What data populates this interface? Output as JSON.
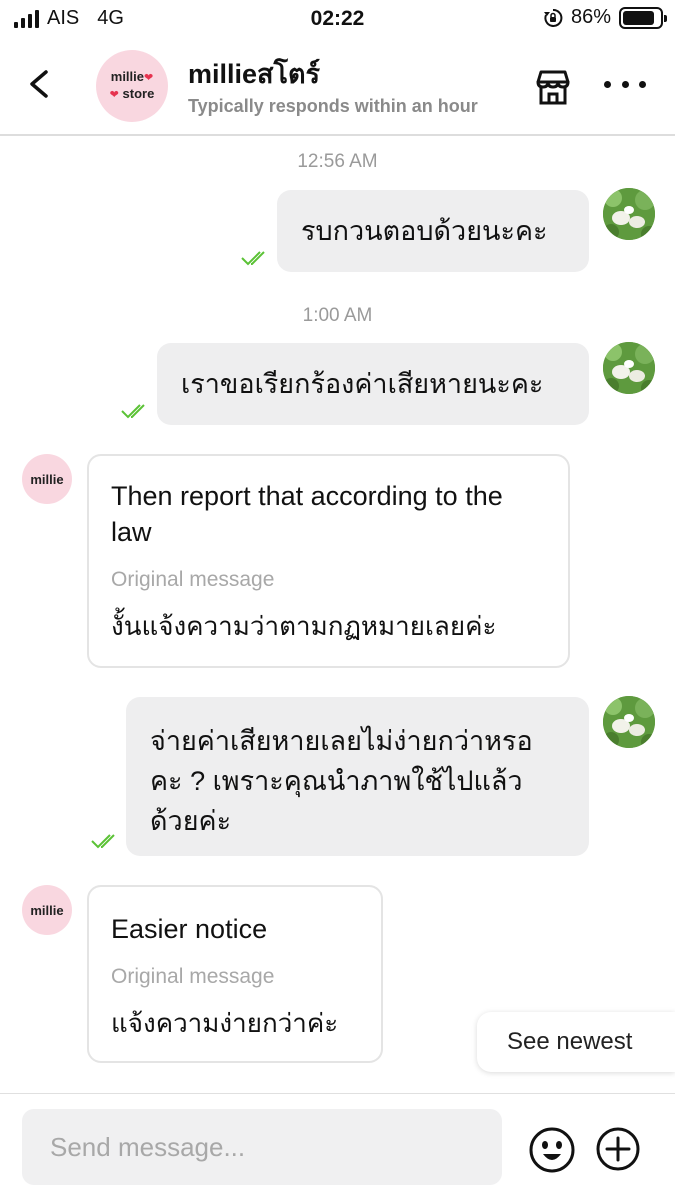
{
  "status_bar": {
    "carrier": "AIS",
    "network": "4G",
    "time": "02:22",
    "battery": "86%"
  },
  "header": {
    "avatar_line1": "millie",
    "avatar_line2": "store",
    "title": "millieสโตร์",
    "subtitle": "Typically responds within an hour"
  },
  "messages": [
    {
      "type": "timestamp",
      "text": "12:56 AM"
    },
    {
      "type": "outgoing",
      "text": "รบกวนตอบด้วยนะคะ"
    },
    {
      "type": "timestamp",
      "text": "1:00 AM"
    },
    {
      "type": "outgoing",
      "text": "เราขอเรียกร้องค่าเสียหายนะคะ"
    },
    {
      "type": "incoming",
      "avatar": "millie",
      "translation": "Then report that according to the law",
      "original_label": "Original message",
      "original": "งั้นแจ้งความว่าตามกฏหมายเลยค่ะ"
    },
    {
      "type": "outgoing",
      "text": "จ่ายค่าเสียหายเลยไม่ง่ายกว่าหรอคะ ? เพราะคุณนำภาพใช้ไปแล้วด้วยค่ะ"
    },
    {
      "type": "incoming",
      "avatar": "millie",
      "translation": "Easier notice",
      "original_label": "Original message",
      "original": "แจ้งความง่ายกว่าค่ะ"
    }
  ],
  "see_newest_label": "See newest",
  "composer": {
    "placeholder": "Send message...",
    "value": ""
  },
  "colors": {
    "read_tick": "#5bc236",
    "avatar_pink": "#f9d7e0",
    "heart": "#e6334f"
  },
  "icons": [
    "back-arrow-icon",
    "store-icon",
    "more-icon",
    "emoji-icon",
    "plus-circle-icon",
    "double-check-icon"
  ]
}
